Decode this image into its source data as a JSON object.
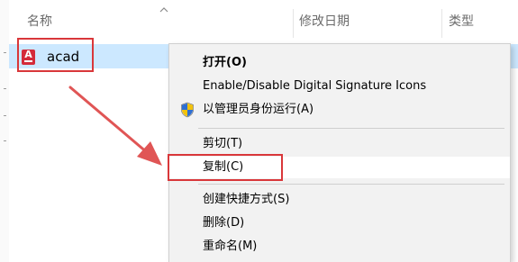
{
  "columns": {
    "name": "名称",
    "modified": "修改日期",
    "type": "类型"
  },
  "file": {
    "name": "acad",
    "icon": "autocad-file-icon",
    "icon_letter": "A"
  },
  "context_menu": {
    "items": [
      {
        "label": "打开(O)",
        "bold": true
      },
      {
        "label": "Enable/Disable Digital Signature Icons"
      },
      {
        "label": "以管理员身份运行(A)",
        "icon": "uac-shield-icon"
      },
      {
        "label": "剪切(T)"
      },
      {
        "label": "复制(C)",
        "hovered": true
      },
      {
        "label": "创建快捷方式(S)"
      },
      {
        "label": "删除(D)"
      },
      {
        "label": "重命名(M)"
      }
    ]
  },
  "colors": {
    "selection": "#cce8ff",
    "annotation_red": "#d9373a",
    "menu_bg": "#f2f2f2"
  }
}
